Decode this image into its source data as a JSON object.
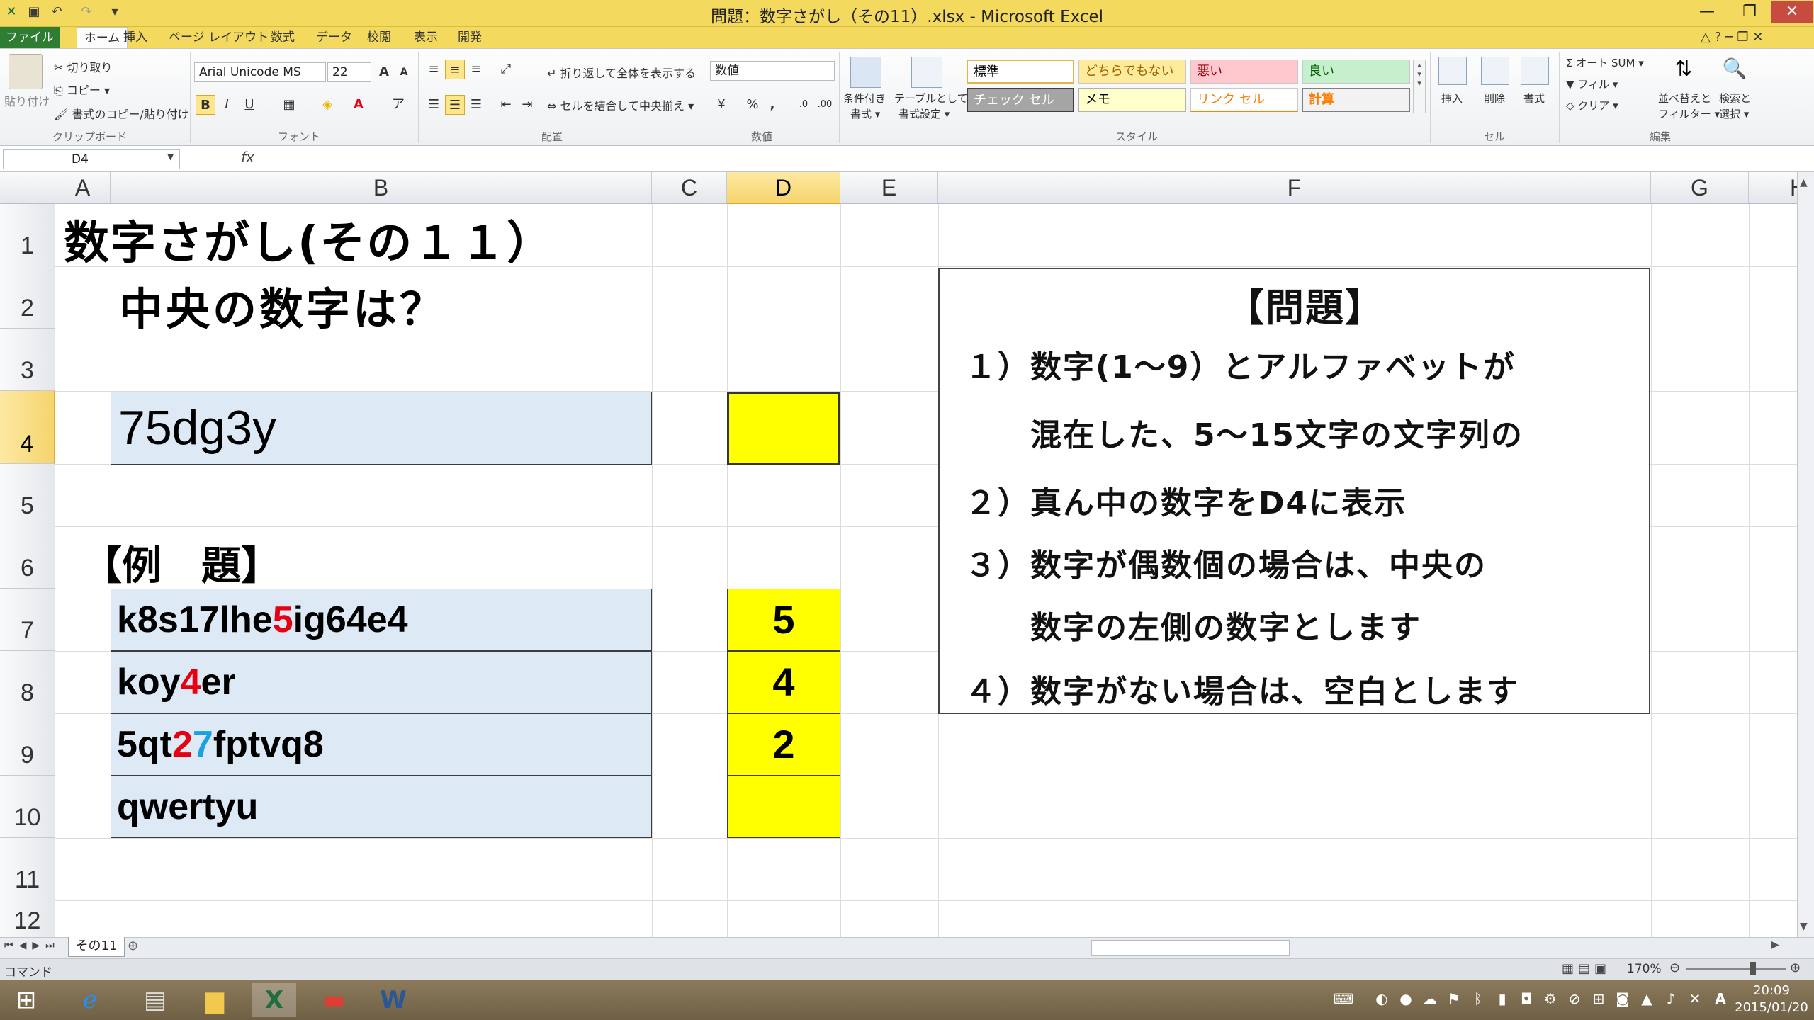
{
  "window": {
    "title": "問題：数字さがし（その11）.xlsx - Microsoft Excel",
    "minimize": "—",
    "restore": "❐",
    "close": "✕"
  },
  "tabs": [
    "ファイル",
    "ホーム",
    "挿入",
    "ページ レイアウト",
    "数式",
    "データ",
    "校閲",
    "表示",
    "開発"
  ],
  "ribbon": {
    "clipboard": {
      "paste": "貼り付け",
      "cut": "切り取り",
      "copy": "コピー ▾",
      "format_painter": "書式のコピー/貼り付け",
      "group": "クリップボード"
    },
    "font": {
      "name": "Arial Unicode MS",
      "size": "22",
      "bold": "B",
      "italic": "I",
      "underline": "U",
      "group": "フォント"
    },
    "alignment": {
      "wrap": "折り返して全体を表示する",
      "merge": "セルを結合して中央揃え ▾",
      "group": "配置"
    },
    "number": {
      "format": "数値",
      "percent": "%",
      "comma": ",",
      "group": "数値"
    },
    "styles": {
      "conditional": "条件付き",
      "conditional2": "書式 ▾",
      "table": "テーブルとして",
      "table2": "書式設定 ▾",
      "standard": "標準",
      "neutral": "どちらでもない",
      "bad": "悪い",
      "good": "良い",
      "check": "チェック セル",
      "memo": "メモ",
      "link": "リンク セル",
      "calc": "計算",
      "group": "スタイル"
    },
    "cells": {
      "insert": "挿入",
      "delete": "削除",
      "format": "書式",
      "group": "セル"
    },
    "editing": {
      "autosum": "Σ オート SUM ▾",
      "fill": "フィル ▾",
      "clear": "クリア ▾",
      "sort": "並べ替えと",
      "sort2": "フィルター ▾",
      "find": "検索と",
      "find2": "選択 ▾",
      "group": "編集"
    }
  },
  "formula_bar": {
    "name_box": "D4",
    "fx": "fx",
    "value": ""
  },
  "columns": [
    "A",
    "B",
    "C",
    "D",
    "E",
    "F",
    "G",
    "H"
  ],
  "rows": [
    "1",
    "2",
    "3",
    "4",
    "5",
    "6",
    "7",
    "8",
    "9",
    "10",
    "11",
    "12"
  ],
  "sheet": {
    "title": "数字さがし(その１１）",
    "subtitle": "中央の数字は？",
    "input_cell": "75dg3y",
    "answer_cell": "",
    "example_header": "【例　題】",
    "examples": [
      {
        "pre": "k8s17lhe",
        "hi": "5",
        "hi2": "",
        "post": "ig64e4",
        "answer": "5"
      },
      {
        "pre": "koy",
        "hi": "4",
        "hi2": "",
        "post": "er",
        "answer": "4"
      },
      {
        "pre": "5qt",
        "hi": "2",
        "hi2": "7",
        "post": "fptvq8",
        "answer": "2"
      },
      {
        "pre": "qwertyu",
        "hi": "",
        "hi2": "",
        "post": "",
        "answer": ""
      }
    ],
    "problem": {
      "heading": "【問題】",
      "lines": [
        "１）数字(1～9）とアルファベットが",
        "　　混在した、5～15文字の文字列の",
        "２）真ん中の数字をD4に表示",
        "３）数字が偶数個の場合は、中央の",
        "　　数字の左側の数字とします",
        "４）数字がない場合は、空白とします"
      ]
    }
  },
  "sheet_tab": "その11",
  "status": {
    "mode": "コマンド",
    "zoom": "170%"
  },
  "taskbar": {
    "time": "20:09",
    "date": "2015/01/20"
  }
}
